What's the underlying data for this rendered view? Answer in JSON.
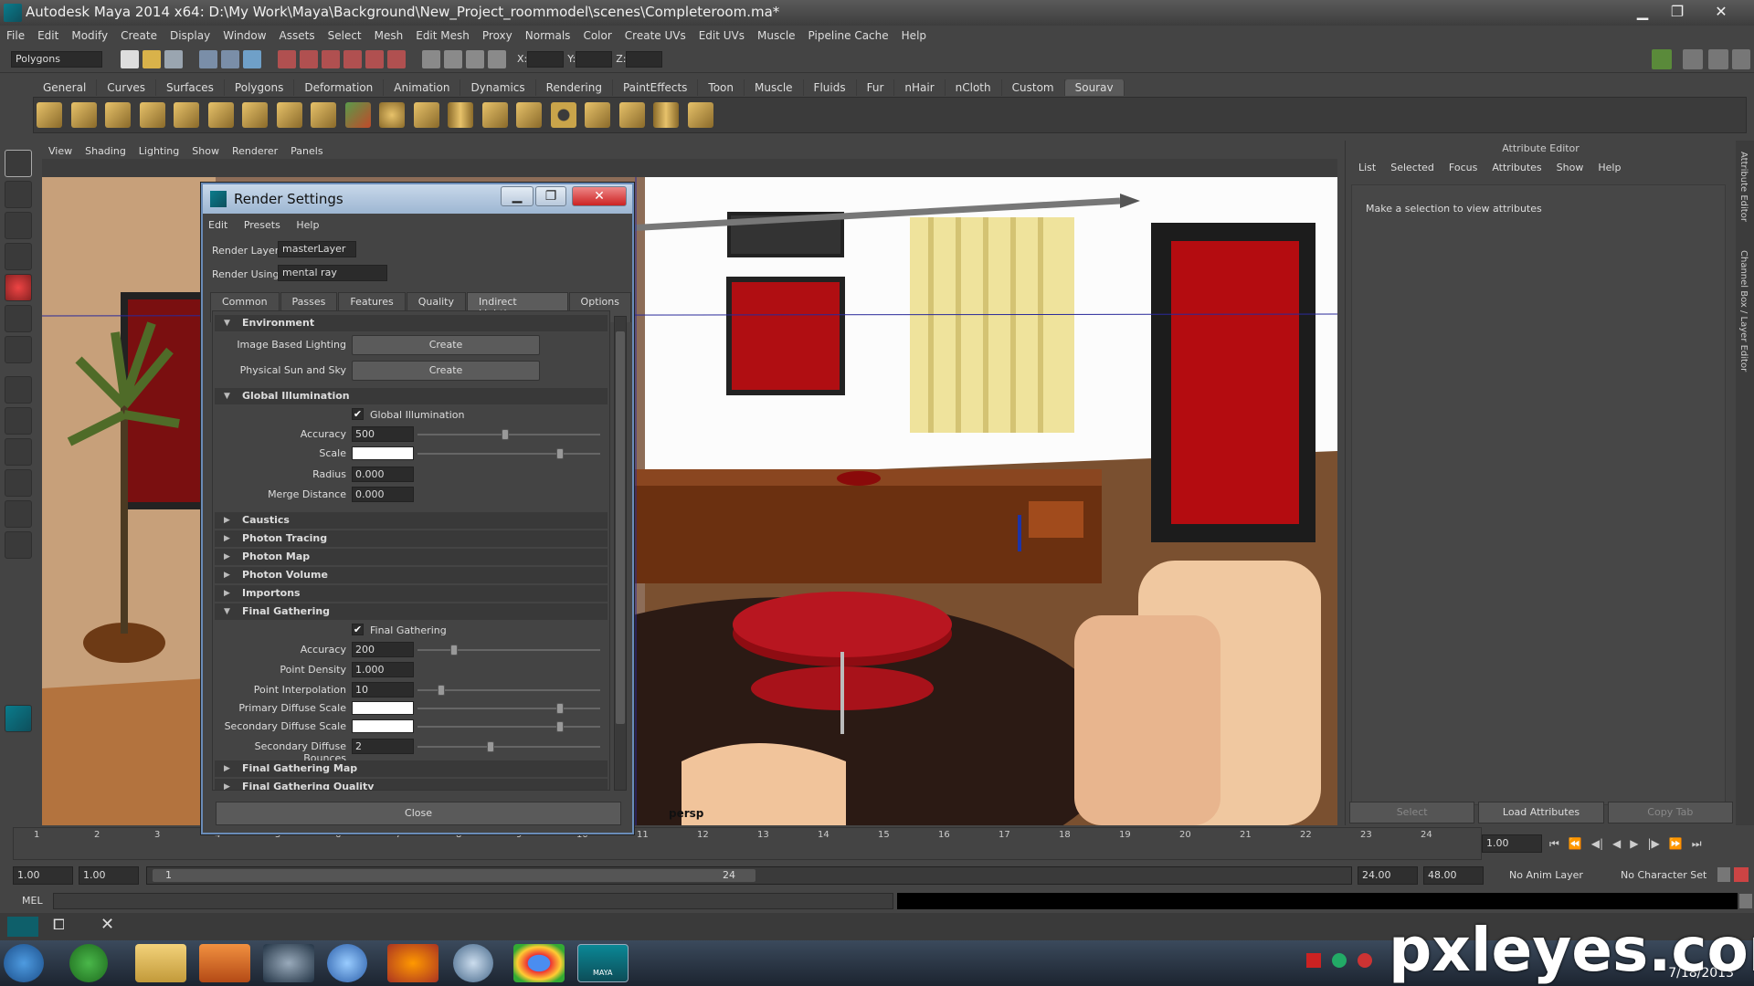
{
  "window": {
    "title": "Autodesk Maya 2014 x64: D:\\My Work\\Maya\\Background\\New_Project_roommodel\\scenes\\Completeroom.ma*"
  },
  "menubar": [
    "File",
    "Edit",
    "Modify",
    "Create",
    "Display",
    "Window",
    "Assets",
    "Select",
    "Mesh",
    "Edit Mesh",
    "Proxy",
    "Normals",
    "Color",
    "Create UVs",
    "Edit UVs",
    "Muscle",
    "Pipeline Cache",
    "Help"
  ],
  "statusline": {
    "mode": "Polygons",
    "x_label": "X:",
    "y_label": "Y:",
    "z_label": "Z:"
  },
  "shelf_tabs": [
    "General",
    "Curves",
    "Surfaces",
    "Polygons",
    "Deformation",
    "Animation",
    "Dynamics",
    "Rendering",
    "PaintEffects",
    "Toon",
    "Muscle",
    "Fluids",
    "Fur",
    "nHair",
    "nCloth",
    "Custom",
    "Sourav"
  ],
  "viewport": {
    "menu": [
      "View",
      "Shading",
      "Lighting",
      "Show",
      "Renderer",
      "Panels"
    ],
    "camera": "persp"
  },
  "render_settings": {
    "title": "Render Settings",
    "menu": [
      "Edit",
      "Presets",
      "Help"
    ],
    "render_layer_label": "Render Layer",
    "render_layer": "masterLayer",
    "render_using_label": "Render Using",
    "render_using": "mental ray",
    "tabs": [
      "Common",
      "Passes",
      "Features",
      "Quality",
      "Indirect Lighting",
      "Options"
    ],
    "env": {
      "title": "Environment",
      "ibl": "Image Based Lighting",
      "pss": "Physical Sun and Sky",
      "create": "Create"
    },
    "gi": {
      "title": "Global Illumination",
      "check": "Global Illumination",
      "accuracy_label": "Accuracy",
      "accuracy": "500",
      "scale_label": "Scale",
      "radius_label": "Radius",
      "radius": "0.000",
      "merge_label": "Merge Distance",
      "merge": "0.000"
    },
    "collapsed": [
      "Caustics",
      "Photon Tracing",
      "Photon Map",
      "Photon Volume",
      "Importons"
    ],
    "fg": {
      "title": "Final Gathering",
      "check": "Final Gathering",
      "accuracy_label": "Accuracy",
      "accuracy": "200",
      "density_label": "Point Density",
      "density": "1.000",
      "interp_label": "Point Interpolation",
      "interp": "10",
      "primary_label": "Primary Diffuse Scale",
      "secondary_label": "Secondary Diffuse Scale",
      "bounces_label": "Secondary Diffuse Bounces",
      "bounces": "2"
    },
    "fg_map": "Final Gathering Map",
    "fg_quality": "Final Gathering Quality",
    "close": "Close"
  },
  "attribute_editor": {
    "title": "Attribute Editor",
    "tabs": [
      "List",
      "Selected",
      "Focus",
      "Attributes",
      "Show",
      "Help"
    ],
    "message": "Make a selection to view attributes",
    "buttons": [
      "Select",
      "Load Attributes",
      "Copy Tab"
    ],
    "side_tabs": [
      "Attribute Editor",
      "Channel Box / Layer Editor"
    ]
  },
  "timeline": {
    "ticks": [
      "1",
      "2",
      "3",
      "4",
      "5",
      "6",
      "7",
      "8",
      "9",
      "10",
      "11",
      "12",
      "13",
      "14",
      "15",
      "16",
      "17",
      "18",
      "19",
      "20",
      "21",
      "22",
      "23",
      "24"
    ],
    "current": "1.00",
    "range_start": "1.00",
    "range_start2": "1.00",
    "range_slider_start": "1",
    "range_slider_end": "24",
    "range_end": "24.00",
    "range_end2": "48.00",
    "anim_layer": "No Anim Layer",
    "char_set": "No Character Set"
  },
  "mel_label": "MEL",
  "taskbar": {
    "date": "7/18/2013",
    "maya_label": "MAYA"
  },
  "watermark": "pxleyes.com"
}
